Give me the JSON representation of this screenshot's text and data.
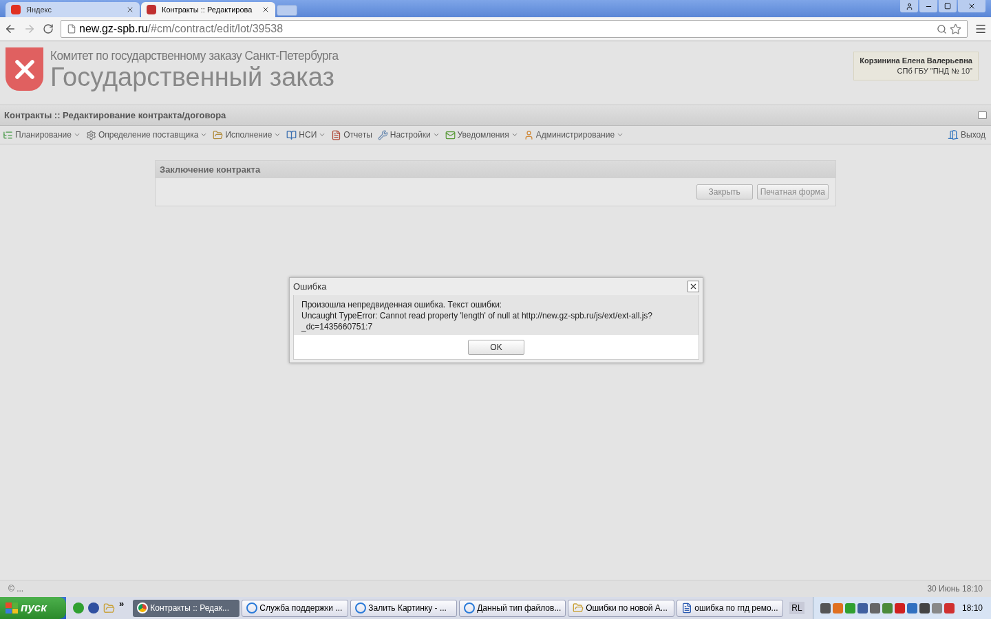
{
  "browser_tabs": [
    {
      "label": "Яндекс",
      "selected": false
    },
    {
      "label": "Контракты :: Редактирова",
      "selected": true
    }
  ],
  "address_bar": {
    "host": "new.gz-spb.ru",
    "path": "/#cm/contract/edit/lot/39538"
  },
  "header": {
    "subtitle": "Комитет по государственному заказу Санкт-Петербурга",
    "title": "Государственный заказ",
    "user_name": "Корзинина Елена Валерьевна",
    "user_org": "СПб ГБУ \"ПНД № 10\""
  },
  "page_title": "Контракты :: Редактирование контракта/договора",
  "menu": [
    {
      "label": "Планирование",
      "dropdown": true
    },
    {
      "label": "Определение поставщика",
      "dropdown": true
    },
    {
      "label": "Исполнение",
      "dropdown": true
    },
    {
      "label": "НСИ",
      "dropdown": true
    },
    {
      "label": "Отчеты",
      "dropdown": false
    },
    {
      "label": "Настройки",
      "dropdown": true
    },
    {
      "label": "Уведомления",
      "dropdown": true
    },
    {
      "label": "Администрирование",
      "dropdown": true
    }
  ],
  "logout": "Выход",
  "panel": {
    "title": "Заключение контракта",
    "buttons": [
      "Закрыть",
      "Печатная форма"
    ]
  },
  "dialog": {
    "title": "Ошибка",
    "lines": [
      "Произошла непредвиденная ошибка. Текст ошибки:",
      "Uncaught TypeError: Cannot read property 'length' of null at http://new.gz-spb.ru/js/ext/ext-all.js?",
      "_dc=1435660751:7"
    ],
    "ok": "OK"
  },
  "footer": {
    "left": "© ...",
    "right": "30 Июнь 18:10"
  },
  "taskbar": {
    "start": "пуск",
    "quick_launch_more": "»",
    "tasks": [
      {
        "label": "Контракты :: Редак...",
        "kind": "chrome",
        "selected": true
      },
      {
        "label": "Служба поддержки ...",
        "kind": "ie",
        "selected": false
      },
      {
        "label": "Залить Картинку - ...",
        "kind": "ie",
        "selected": false
      },
      {
        "label": "Данный тип файлов...",
        "kind": "ie",
        "selected": false
      },
      {
        "label": "Ошибки по новой А...",
        "kind": "folder",
        "selected": false
      },
      {
        "label": "ошибка по гпд ремо...",
        "kind": "word",
        "selected": false
      }
    ],
    "language": "RL",
    "clock": "18:10"
  }
}
